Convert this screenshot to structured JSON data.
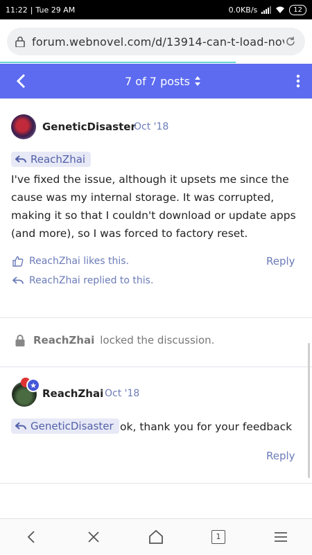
{
  "status_bar": {
    "time": "11:22",
    "date": "Tue 29 AM",
    "network_speed": "0.0KB/s",
    "battery": "12"
  },
  "browser": {
    "url": "forum.webnovel.com/d/13914-can-t-load-nov"
  },
  "header": {
    "title": "7 of 7 posts"
  },
  "post1": {
    "author": "GeneticDisaster",
    "date": "Oct '18",
    "mention": "ReachZhai",
    "body": "I've fixed the issue, although it upsets me since the cause was my internal storage. It was corrupted, making it so that I couldn't download or update apps (and more), so I was forced to factory reset.",
    "likes": "ReachZhai likes this.",
    "replied": "ReachZhai replied to this.",
    "reply_label": "Reply"
  },
  "event": {
    "user": "ReachZhai",
    "action": "locked the discussion."
  },
  "post2": {
    "author": "ReachZhai",
    "date": "Oct '18",
    "mention": "GeneticDisaster",
    "body": "ok, thank you for your feedback",
    "reply_label": "Reply"
  },
  "bottom_nav": {
    "tab_count": "1"
  },
  "colors": {
    "header": "#5c6bf0",
    "accent_text": "#6b7bb8",
    "mention_bg": "#e7e9f6"
  }
}
